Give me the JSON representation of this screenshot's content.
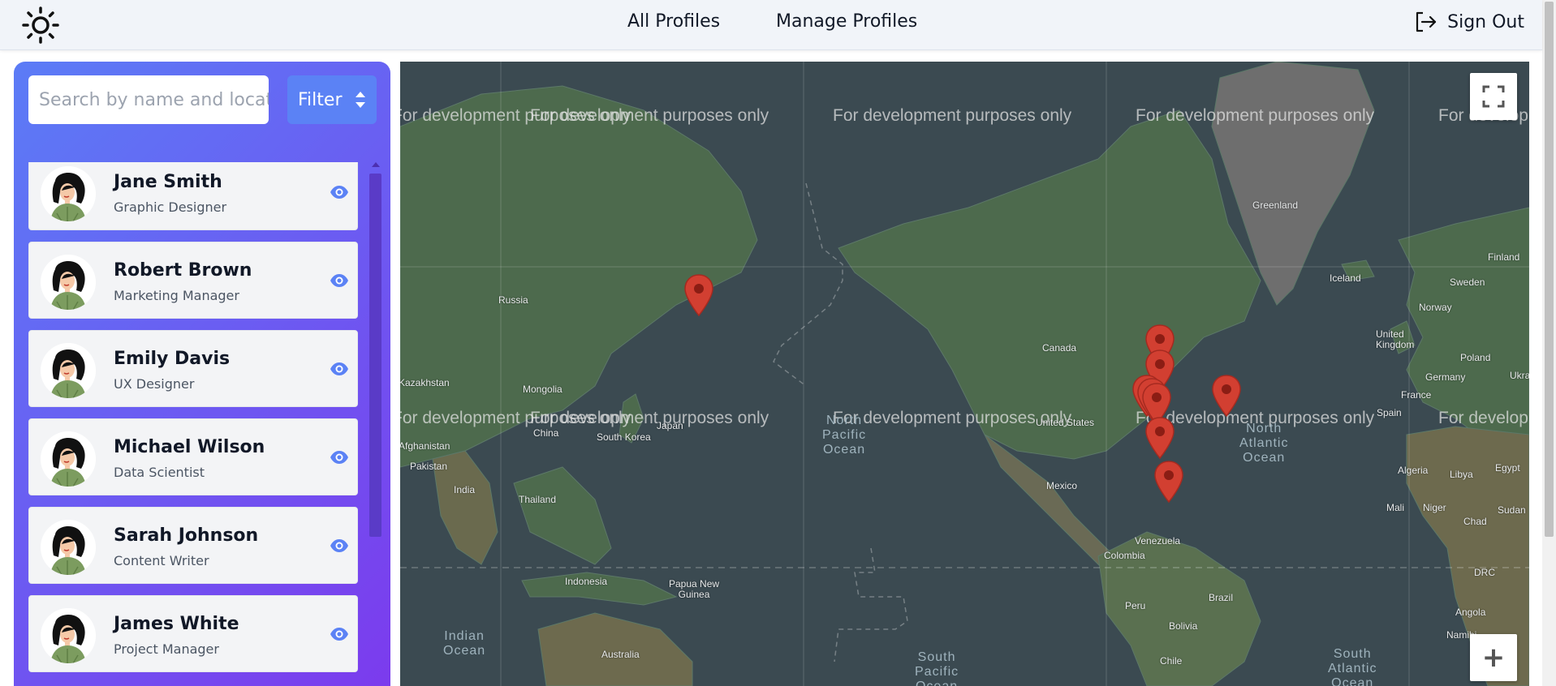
{
  "header": {
    "nav": [
      {
        "label": "All Profiles"
      },
      {
        "label": "Manage Profiles"
      }
    ],
    "sign_out": "Sign Out",
    "logo_icon": "sun-icon"
  },
  "sidebar": {
    "search_placeholder": "Search by name and location",
    "filter_label": "Filter",
    "profiles": [
      {
        "name": "Jane Smith",
        "role": "Graphic Designer"
      },
      {
        "name": "Robert Brown",
        "role": "Marketing Manager"
      },
      {
        "name": "Emily Davis",
        "role": "UX Designer"
      },
      {
        "name": "Michael Wilson",
        "role": "Data Scientist"
      },
      {
        "name": "Sarah Johnson",
        "role": "Content Writer"
      },
      {
        "name": "James White",
        "role": "Project Manager"
      }
    ]
  },
  "map": {
    "watermark": "For development purposes only",
    "labels": {
      "greenland": "Greenland",
      "iceland": "Iceland",
      "finland": "Finland",
      "sweden": "Sweden",
      "norway": "Norway",
      "uk": "United\nKingdom",
      "poland": "Poland",
      "germany": "Germany",
      "ukraine": "Ukrai",
      "france": "France",
      "spain": "Spain",
      "russia": "Russia",
      "kazakhstan": "Kazakhstan",
      "mongolia": "Mongolia",
      "china": "China",
      "south_korea": "South Korea",
      "japan": "Japan",
      "afghanistan": "Afghanistan",
      "pakistan": "Pakistan",
      "india": "India",
      "thailand": "Thailand",
      "indonesia": "Indonesia",
      "papua": "Papua New\nGuinea",
      "australia": "Australia",
      "canada": "Canada",
      "usa": "United States",
      "mexico": "Mexico",
      "venezuela": "Venezuela",
      "colombia": "Colombia",
      "peru": "Peru",
      "brazil": "Brazil",
      "bolivia": "Bolivia",
      "chile": "Chile",
      "algeria": "Algeria",
      "libya": "Libya",
      "egypt": "Egypt",
      "mali": "Mali",
      "niger": "Niger",
      "chad": "Chad",
      "sudan": "Sudan",
      "drc": "DRC",
      "angola": "Angola",
      "namibia": "Namibi"
    },
    "oceans": {
      "north_pacific": "North\nPacific\nOcean",
      "north_atlantic": "North\nAtlantic\nOcean",
      "indian": "Indian\nOcean",
      "south_pacific": "South\nPacific\nOcean",
      "south_atlantic": "South\nAtlantic\nOcean"
    },
    "fullscreen_icon": "fullscreen-icon",
    "zoom_in": "+"
  },
  "colors": {
    "gradient_start": "#5b7cf6",
    "gradient_end": "#7c3aed",
    "marker": "#d23f31",
    "eye": "#5b82f5"
  }
}
